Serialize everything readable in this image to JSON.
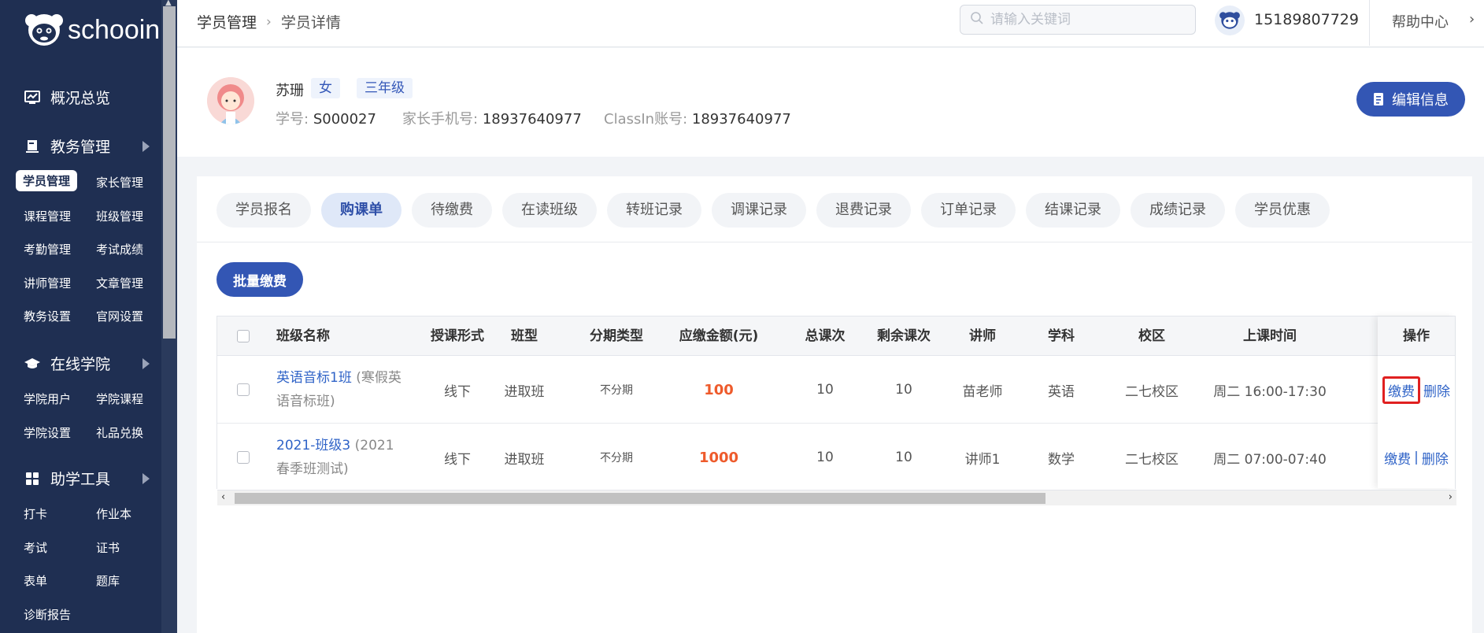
{
  "sidebar": {
    "logo_text": "schooin",
    "sections": [
      {
        "label": "概况总览"
      },
      {
        "label": "教务管理"
      },
      {
        "label": "在线学院"
      },
      {
        "label": "助学工具"
      }
    ],
    "edu_items": [
      "学员管理",
      "家长管理",
      "课程管理",
      "班级管理",
      "考勤管理",
      "考试成绩",
      "讲师管理",
      "文章管理",
      "教务设置",
      "官网设置"
    ],
    "online_items": [
      "学院用户",
      "学院课程",
      "学院设置",
      "礼品兑换"
    ],
    "tool_items": [
      "打卡",
      "作业本",
      "考试",
      "证书",
      "表单",
      "题库",
      "诊断报告"
    ]
  },
  "topbar": {
    "breadcrumb_root": "学员管理",
    "breadcrumb_current": "学员详情",
    "search_placeholder": "请输入关键词",
    "phone": "15189807729",
    "help": "帮助中心"
  },
  "profile": {
    "name": "苏珊",
    "gender": "女",
    "grade": "三年级",
    "student_no_label": "学号:",
    "student_no": "S000027",
    "parent_phone_label": "家长手机号:",
    "parent_phone": "18937640977",
    "classin_label": "ClassIn账号:",
    "classin": "18937640977",
    "edit_label": "编辑信息"
  },
  "tabs": [
    "学员报名",
    "购课单",
    "待缴费",
    "在读班级",
    "转班记录",
    "调课记录",
    "退费记录",
    "订单记录",
    "结课记录",
    "成绩记录",
    "学员优惠"
  ],
  "batch_pay_label": "批量缴费",
  "table": {
    "headers": [
      "班级名称",
      "授课形式",
      "班型",
      "分期类型",
      "应缴金额(元)",
      "总课次",
      "剩余课次",
      "讲师",
      "学科",
      "校区",
      "上课时间",
      "操作"
    ],
    "rows": [
      {
        "class_link": "英语音标1班",
        "class_line1_rest": " (寒假英",
        "class_line2": "语音标班)",
        "mode": "线下",
        "type": "进取班",
        "installment": "不分期",
        "amount": "100",
        "total": "10",
        "remaining": "10",
        "teacher": "苗老师",
        "subject": "英语",
        "campus": "二七校区",
        "time": "周二 16:00-17:30",
        "pay": "缴费",
        "delete": "删除"
      },
      {
        "class_link": "2021-班级3",
        "class_line1_rest": " (2021",
        "class_line2": "春季班测试)",
        "mode": "线下",
        "type": "进取班",
        "installment": "不分期",
        "amount": "1000",
        "total": "10",
        "remaining": "10",
        "teacher": "讲师1",
        "subject": "数学",
        "campus": "二七校区",
        "time": "周二 07:00-07:40",
        "pay": "缴费",
        "separator": "|",
        "delete": "删除"
      }
    ]
  },
  "colors": {
    "sidebar_bg": "#1f2f52",
    "primary": "#3356b4",
    "link": "#2f63c7",
    "amount": "#ee5b2c",
    "highlight": "#e02020"
  }
}
